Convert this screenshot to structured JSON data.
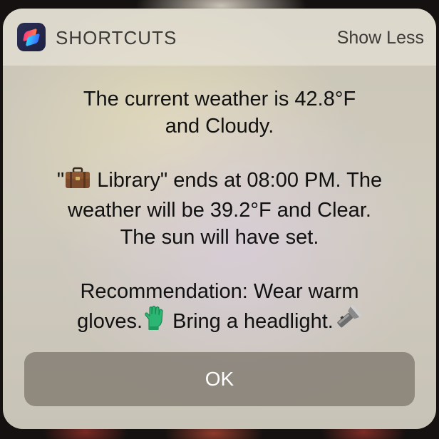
{
  "notification": {
    "app_name": "SHORTCUTS",
    "app_icon": "shortcuts-app-icon",
    "show_less_label": "Show Less",
    "message": {
      "line1": "The current weather is 42.8°F",
      "line2": "and Cloudy.",
      "line3_quote_open": "\"",
      "line3_icon": "briefcase-icon",
      "line3_rest": " Library\" ends at 08:00 PM. The",
      "line4": "weather will be 39.2°F and Clear.",
      "line5": "The sun will have set.",
      "line6": "Recommendation: Wear warm",
      "line7a": "gloves.",
      "line7_icon1": "glove-icon",
      "line7b": "  Bring a headlight.",
      "line7_icon2": "flashlight-icon"
    },
    "ok_label": "OK"
  },
  "colors": {
    "card_background": "#cbc6b7",
    "button_background": "#787268",
    "text": "#111111"
  }
}
